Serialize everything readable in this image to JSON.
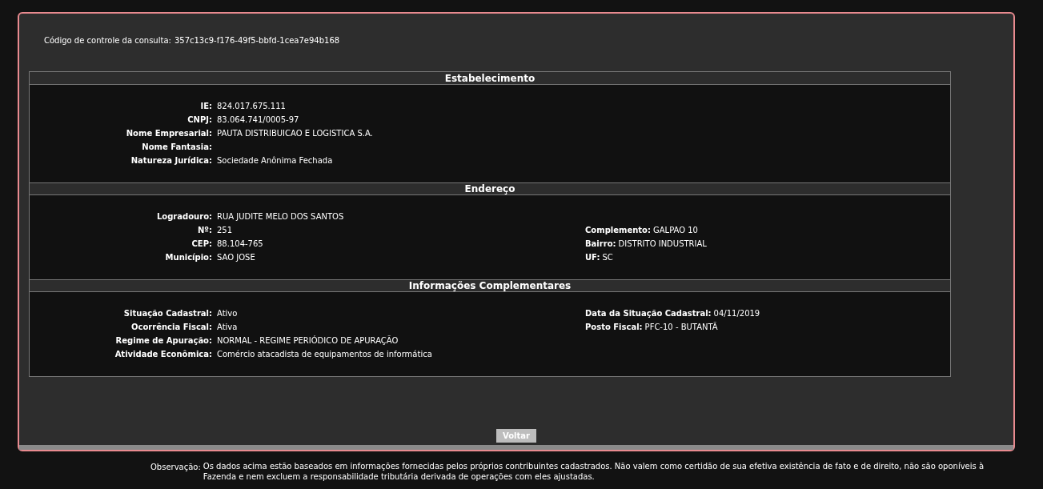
{
  "control_code": {
    "label": "Código de controle da consulta:",
    "value": "357c13c9-f176-49f5-bbfd-1cea7e94b168"
  },
  "sections": [
    {
      "title": "Estabelecimento",
      "rows": [
        {
          "left": {
            "label": "IE:",
            "value": "824.017.675.111"
          }
        },
        {
          "left": {
            "label": "CNPJ:",
            "value": "83.064.741/0005-97"
          }
        },
        {
          "left": {
            "label": "Nome Empresarial:",
            "value": "PAUTA DISTRIBUICAO E LOGISTICA S.A."
          }
        },
        {
          "left": {
            "label": "Nome Fantasia:"
          }
        },
        {
          "left": {
            "label": "Natureza Jurídica:",
            "value": "Sociedade Anônima Fechada"
          }
        }
      ]
    },
    {
      "title": "Endereço",
      "rows": [
        {
          "left": {
            "label": "Logradouro:",
            "value": "RUA JUDITE MELO DOS SANTOS"
          }
        },
        {
          "left": {
            "label": "Nº:",
            "value": "251"
          },
          "right": {
            "label": "Complemento:",
            "value": "GALPAO 10"
          }
        },
        {
          "left": {
            "label": "CEP:",
            "value": "88.104-765"
          },
          "right": {
            "label": "Bairro:",
            "value": "DISTRITO INDUSTRIAL"
          }
        },
        {
          "left": {
            "label": "Município:",
            "value": "SAO JOSE"
          },
          "right": {
            "label": "UF:",
            "value": "SC"
          }
        }
      ]
    },
    {
      "title": "Informações Complementares",
      "rows": [
        {
          "left": {
            "label": "Situação Cadastral:",
            "value": "Ativo"
          },
          "right": {
            "label": "Data da Situação Cadastral:",
            "value": "04/11/2019"
          }
        },
        {
          "left": {
            "label": "Ocorrência Fiscal:",
            "value": "Ativa"
          },
          "right": {
            "label": "Posto Fiscal:",
            "value": "PFC-10 - BUTANTÃ"
          }
        },
        {
          "left": {
            "label": "Regime de Apuração:",
            "value": "NORMAL - REGIME PERIÓDICO DE APURAÇÃO"
          }
        },
        {
          "left": {
            "label": "Atividade Econômica:",
            "value": "Comércio atacadista de equipamentos de informática"
          }
        }
      ]
    }
  ],
  "back_button": "Voltar",
  "observation": {
    "label": "Observação:",
    "text": "Os dados acima estão baseados em informações fornecidas pelos próprios contribuintes cadastrados. Não valem como certidão de sua efetiva existência de fato e de direito, não são oponíveis à Fazenda e nem excluem a responsabilidade tributária derivada de operações com eles ajustadas."
  }
}
